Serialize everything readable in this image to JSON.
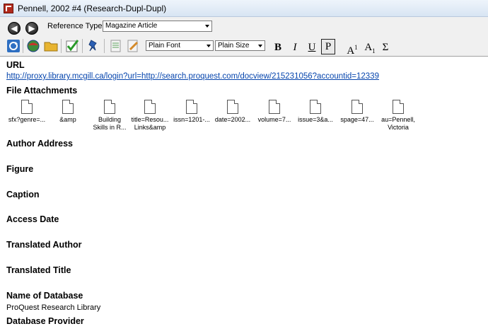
{
  "window": {
    "title": "Pennell, 2002 #4 (Research-Dupl-Dupl)"
  },
  "toolbar": {
    "back_glyph": "◀",
    "forward_glyph": "▶",
    "reference_type_label": "Reference Type:",
    "reference_type_value": "Magazine Article",
    "font_value": "Plain Font",
    "size_value": "Plain Size",
    "bold": "B",
    "italic": "I",
    "underline": "U",
    "plain": "P",
    "superscript_base": "A",
    "superscript_mark": "1",
    "subscript_base": "A",
    "subscript_mark": "1",
    "symbol": "Σ",
    "icons": [
      "refresh-icon",
      "globe-icon",
      "folder-icon",
      "checklist-icon",
      "pin-icon",
      "note-icon",
      "edit-note-icon"
    ]
  },
  "fields": {
    "url_label": "URL",
    "url_value": "http://proxy.library.mcgill.ca/login?url=http://search.proquest.com/docview/215231056?accountid=12339",
    "attachments_label": "File Attachments",
    "attachments": [
      {
        "line1": "sfx?genre=...",
        "line2": ""
      },
      {
        "line1": "&amp",
        "line2": ""
      },
      {
        "line1": "Building",
        "line2": "Skills in R..."
      },
      {
        "line1": "title=Resou...",
        "line2": "Links&amp"
      },
      {
        "line1": "issn=1201-...",
        "line2": ""
      },
      {
        "line1": "date=2002...",
        "line2": ""
      },
      {
        "line1": "volume=7...",
        "line2": ""
      },
      {
        "line1": "issue=3&a...",
        "line2": ""
      },
      {
        "line1": "spage=47...",
        "line2": ""
      },
      {
        "line1": "au=Pennell,",
        "line2": "Victoria"
      }
    ],
    "author_address_label": "Author Address",
    "figure_label": "Figure",
    "caption_label": "Caption",
    "access_date_label": "Access Date",
    "translated_author_label": "Translated Author",
    "translated_title_label": "Translated Title",
    "name_of_database_label": "Name of Database",
    "name_of_database_value": "ProQuest Research Library",
    "database_provider_label": "Database Provider"
  }
}
